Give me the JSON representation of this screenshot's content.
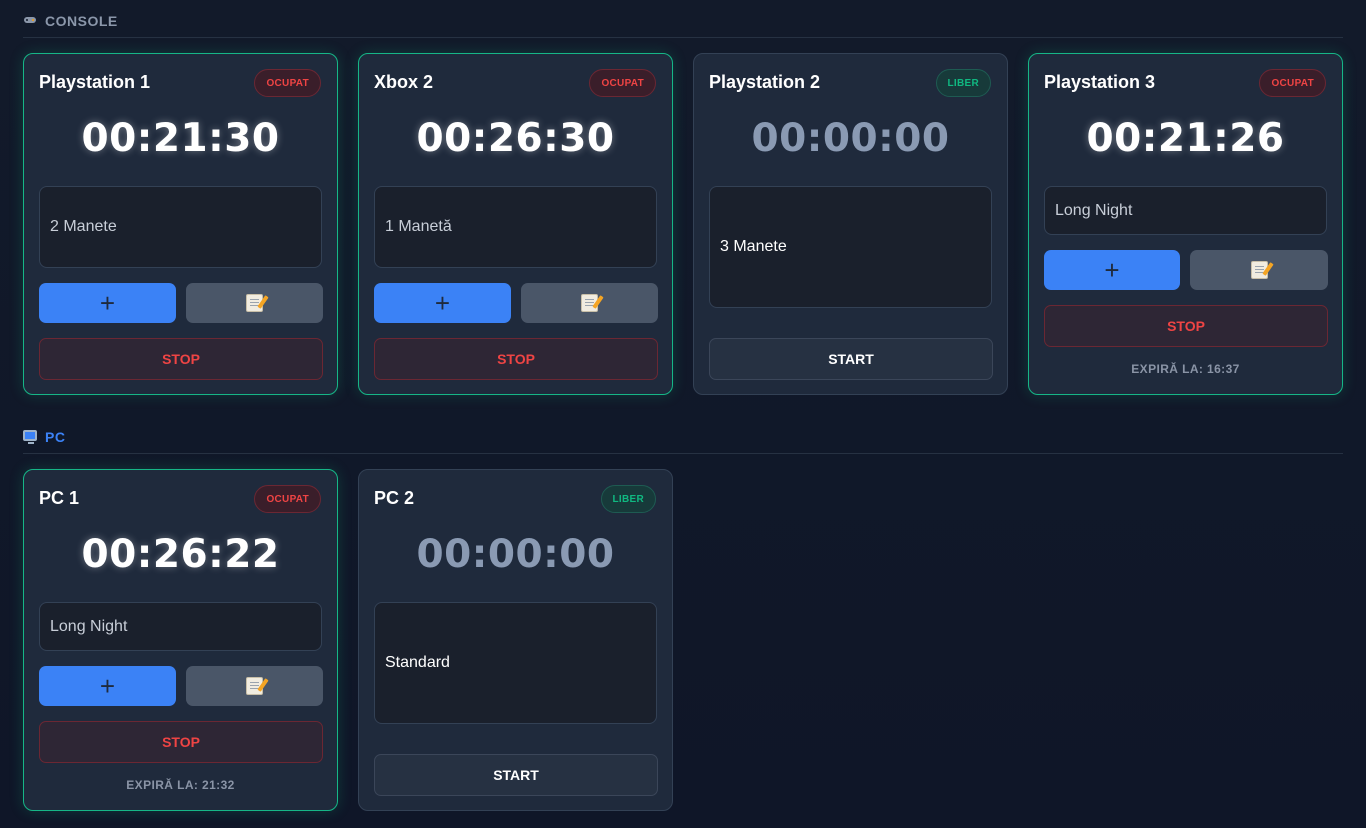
{
  "sections": {
    "console": {
      "icon": "gamepad-icon",
      "title": "CONSOLE"
    },
    "pc": {
      "icon": "monitor-icon",
      "title": "PC"
    }
  },
  "colors": {
    "accent_blue": "#3b82f6",
    "busy_green": "#10b981",
    "danger_red": "#ef4444",
    "background": "#121a2a"
  },
  "stations": [
    {
      "name": "Playstation 1",
      "status": "OCUPAT",
      "timer": "00:21:30",
      "package": "2 Manete",
      "add_label": "+",
      "stop_label": "STOP"
    },
    {
      "name": "Xbox 2",
      "status": "OCUPAT",
      "timer": "00:26:30",
      "package": "1 Manetă",
      "add_label": "+",
      "stop_label": "STOP"
    },
    {
      "name": "Playstation 2",
      "status": "LIBER",
      "timer": "00:00:00",
      "package": "3 Manete",
      "start_label": "START"
    },
    {
      "name": "Playstation 3",
      "status": "OCUPAT",
      "timer": "00:21:26",
      "package": "Long Night",
      "add_label": "+",
      "stop_label": "STOP",
      "expires": "EXPIRĂ LA: 16:37"
    },
    {
      "name": "PC 1",
      "status": "OCUPAT",
      "timer": "00:26:22",
      "package": "Long Night",
      "add_label": "+",
      "stop_label": "STOP",
      "expires": "EXPIRĂ LA: 21:32"
    },
    {
      "name": "PC 2",
      "status": "LIBER",
      "timer": "00:00:00",
      "package": "Standard",
      "start_label": "START"
    }
  ]
}
